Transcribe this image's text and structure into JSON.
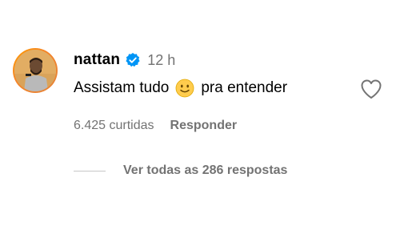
{
  "comment": {
    "username": "nattan",
    "verified_icon": "verified-badge-icon",
    "time": "12 h",
    "text_before_emoji": "Assistam tudo",
    "emoji": "slightly-smiling-face",
    "text_after_emoji": "pra entender",
    "likes": "6.425 curtidas",
    "reply_label": "Responder",
    "view_replies_label": "Ver todas as 286 respostas"
  },
  "colors": {
    "primary_text": "#000000",
    "secondary_text": "#737373",
    "verified_blue": "#0095f6",
    "avatar_ring": "#f58529",
    "divider": "#c7c7c7"
  }
}
